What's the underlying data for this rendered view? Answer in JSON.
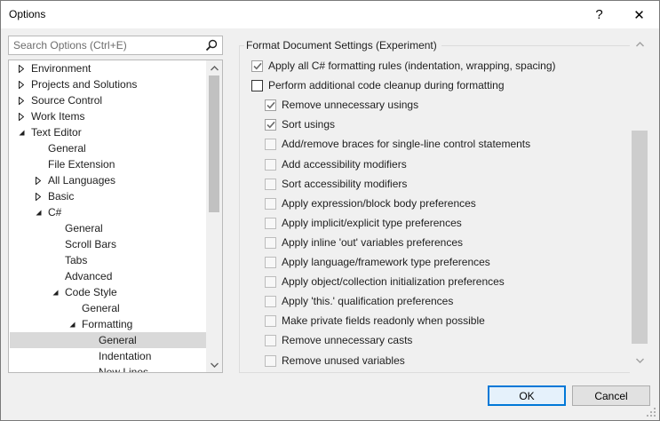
{
  "window": {
    "title": "Options",
    "help_glyph": "?",
    "close_glyph": "✕"
  },
  "search": {
    "placeholder": "Search Options (Ctrl+E)",
    "value": ""
  },
  "tree": {
    "items": [
      {
        "label": "Environment",
        "arrow": "collapsed",
        "level": 0
      },
      {
        "label": "Projects and Solutions",
        "arrow": "collapsed",
        "level": 0
      },
      {
        "label": "Source Control",
        "arrow": "collapsed",
        "level": 0
      },
      {
        "label": "Work Items",
        "arrow": "collapsed",
        "level": 0
      },
      {
        "label": "Text Editor",
        "arrow": "expanded",
        "level": 0
      },
      {
        "label": "General",
        "arrow": "none",
        "level": 1
      },
      {
        "label": "File Extension",
        "arrow": "none",
        "level": 1
      },
      {
        "label": "All Languages",
        "arrow": "collapsed",
        "level": 1
      },
      {
        "label": "Basic",
        "arrow": "collapsed",
        "level": 1
      },
      {
        "label": "C#",
        "arrow": "expanded",
        "level": 1
      },
      {
        "label": "General",
        "arrow": "none",
        "level": 2
      },
      {
        "label": "Scroll Bars",
        "arrow": "none",
        "level": 2
      },
      {
        "label": "Tabs",
        "arrow": "none",
        "level": 2
      },
      {
        "label": "Advanced",
        "arrow": "none",
        "level": 2
      },
      {
        "label": "Code Style",
        "arrow": "expanded",
        "level": 2
      },
      {
        "label": "General",
        "arrow": "none",
        "level": 3
      },
      {
        "label": "Formatting",
        "arrow": "expanded",
        "level": 3
      },
      {
        "label": "General",
        "arrow": "none",
        "level": 4,
        "selected": true
      },
      {
        "label": "Indentation",
        "arrow": "none",
        "level": 4
      },
      {
        "label": "New Lines",
        "arrow": "none",
        "level": 4
      }
    ]
  },
  "settings": {
    "group_title": "Format Document Settings (Experiment)",
    "options": [
      {
        "label": "Apply all C# formatting rules (indentation, wrapping, spacing)",
        "state": "checked-dim",
        "indent": 0
      },
      {
        "label": "Perform additional code cleanup during formatting",
        "state": "unchecked",
        "indent": 0
      },
      {
        "label": "Remove unnecessary usings",
        "state": "checked-dim",
        "indent": 1
      },
      {
        "label": "Sort usings",
        "state": "checked-dim",
        "indent": 1
      },
      {
        "label": "Add/remove braces for single-line control statements",
        "state": "dim",
        "indent": 1
      },
      {
        "label": "Add accessibility modifiers",
        "state": "dim",
        "indent": 1
      },
      {
        "label": "Sort accessibility modifiers",
        "state": "dim",
        "indent": 1
      },
      {
        "label": "Apply expression/block body preferences",
        "state": "dim",
        "indent": 1
      },
      {
        "label": "Apply implicit/explicit type preferences",
        "state": "dim",
        "indent": 1
      },
      {
        "label": "Apply inline 'out' variables preferences",
        "state": "dim",
        "indent": 1
      },
      {
        "label": "Apply language/framework type preferences",
        "state": "dim",
        "indent": 1
      },
      {
        "label": "Apply object/collection initialization preferences",
        "state": "dim",
        "indent": 1
      },
      {
        "label": "Apply 'this.' qualification preferences",
        "state": "dim",
        "indent": 1
      },
      {
        "label": "Make private fields readonly when possible",
        "state": "dim",
        "indent": 1
      },
      {
        "label": "Remove unnecessary casts",
        "state": "dim",
        "indent": 1
      },
      {
        "label": "Remove unused variables",
        "state": "dim",
        "indent": 1
      }
    ]
  },
  "buttons": {
    "ok": "OK",
    "cancel": "Cancel"
  },
  "colors": {
    "selected_row": "#d9d9d9",
    "primary_border": "#0078d7"
  }
}
